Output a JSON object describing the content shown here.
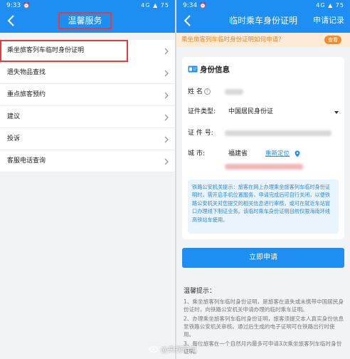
{
  "left": {
    "status_time": "9:33",
    "status_icons": "4G ▲ 75",
    "title": "温馨服务",
    "menu": [
      "乘坐旅客列车临时身份证明",
      "遗失物品查找",
      "重点旅客预约",
      "建议",
      "投诉",
      "客服电话查询"
    ]
  },
  "right": {
    "status_time": "9:34",
    "status_icons": "4G ▲ 75",
    "title": "临时乘车身份证明",
    "action": "申请记录",
    "notice": "乘坐旅客列车临时身份证明如何申请？",
    "notice_button": "查看",
    "card": {
      "title": "身份信息",
      "name_label": "姓    名",
      "id_type_label": "证件类型:",
      "id_type_value": "中国居民身份证",
      "id_no_label": "证  件  号:",
      "city_label": "城      市:",
      "city_value": "福建省",
      "relocate": "重新定位",
      "tip": "铁路公安机关提示：旅客在网上办理乘坐旅客列车临时身份证明时，需开启手机位置服务，申请完成后可自行关闭，以便铁路公安机关对您提交的相关信息进行审核，或可在就近车站窗口办理线下制证业务。该临时乘车身份证明目前仅限海南环线高铁站车使用。"
    },
    "submit": "立即申请",
    "tips_title": "温馨提示：",
    "tips": [
      "1、乘坐旅客列车临时身份证明，是旅客在遗失或未携带中国居民身份证时，向铁路公安机关申请办理的临时乘车证明。",
      "2、办理乘坐旅客列车临时身份证明，旅客须提交本人真实身份信息至铁路公安机关审核。通过后生成的电子证明可在铁路出行时使用。",
      "3、每位旅客在一个自然月内最多可申请3次乘坐旅客列车临时身份证明。"
    ]
  },
  "watermark": "@央视新闻",
  "colors": {
    "brand_blue": "#1e8ef2",
    "highlight_red": "#e43c3c",
    "notice_orange": "#f08c2c"
  }
}
